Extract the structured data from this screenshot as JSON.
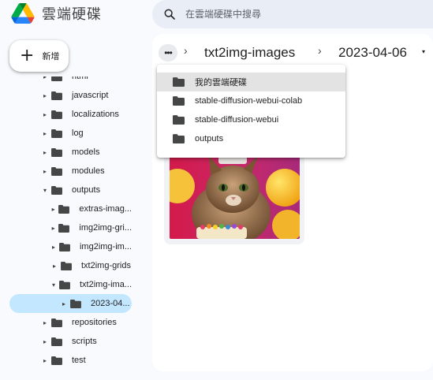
{
  "app": {
    "title": "雲端硬碟"
  },
  "search": {
    "placeholder": "在雲端硬碟中搜尋"
  },
  "new_button": {
    "label": "新增"
  },
  "tree": [
    {
      "label": "html",
      "expanded": false
    },
    {
      "label": "javascript",
      "expanded": false
    },
    {
      "label": "localizations",
      "expanded": false
    },
    {
      "label": "log",
      "expanded": false
    },
    {
      "label": "models",
      "expanded": false
    },
    {
      "label": "modules",
      "expanded": false
    },
    {
      "label": "outputs",
      "expanded": true
    },
    {
      "label": "extras-imag...",
      "expanded": false
    },
    {
      "label": "img2img-gri...",
      "expanded": false
    },
    {
      "label": "img2img-im...",
      "expanded": false
    },
    {
      "label": "txt2img-grids",
      "expanded": false
    },
    {
      "label": "txt2img-ima...",
      "expanded": true
    },
    {
      "label": "2023-04...",
      "expanded": false,
      "selected": true
    },
    {
      "label": "repositories",
      "expanded": false
    },
    {
      "label": "scripts",
      "expanded": false
    },
    {
      "label": "test",
      "expanded": false
    }
  ],
  "breadcrumb": {
    "more": "•••",
    "separator": "›",
    "parent": "txt2img-images",
    "current": "2023-04-06",
    "current_caret": "▾"
  },
  "menu": [
    {
      "label": "我的雲端硬碟"
    },
    {
      "label": "stable-diffusion-webui-colab"
    },
    {
      "label": "stable-diffusion-webui"
    },
    {
      "label": "outputs"
    }
  ],
  "colors": {
    "selected_bg": "#c2e7ff",
    "menu_highlight": "#e3e3e3",
    "search_bg": "#e9eef6",
    "folder": "#444746"
  }
}
